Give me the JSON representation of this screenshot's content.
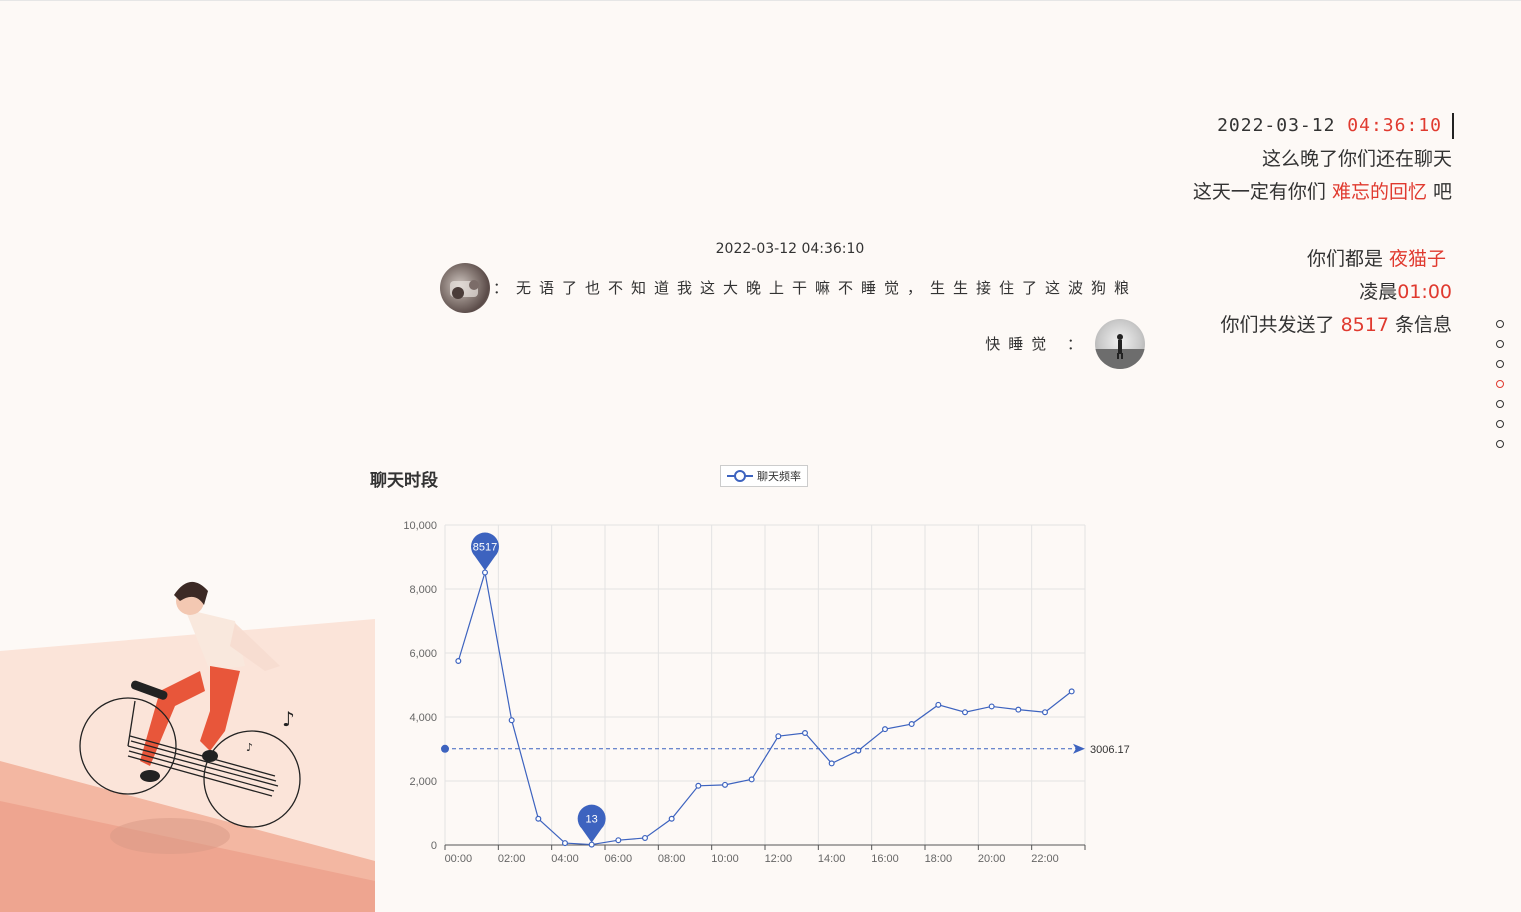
{
  "summary": {
    "date": "2022-03-12",
    "time": "04:36:10",
    "line1": "这么晚了你们还在聊天",
    "line2_prefix": "这天一定有你们 ",
    "line2_highlight": "难忘的回忆",
    "line2_suffix": " 吧",
    "cat_prefix": "你们都是 ",
    "cat_highlight": "夜猫子",
    "early_prefix": "凌晨",
    "early_time": "01:00",
    "count_prefix": "你们共发送了 ",
    "count_value": "8517",
    "count_suffix": " 条信息"
  },
  "chat": {
    "timestamp": "2022-03-12 04:36:10",
    "left_message": "：无语了也不知道我这大晚上干嘛不睡觉，生生接住了这波狗粮",
    "right_message": "快睡觉 ："
  },
  "nav": {
    "dot_count": 7,
    "active_index": 3
  },
  "chart_data": {
    "type": "line",
    "title": "聊天时段",
    "legend": [
      "聊天频率"
    ],
    "x_categories": [
      "00:00",
      "01:00",
      "02:00",
      "03:00",
      "04:00",
      "05:00",
      "06:00",
      "07:00",
      "08:00",
      "09:00",
      "10:00",
      "11:00",
      "12:00",
      "13:00",
      "14:00",
      "15:00",
      "16:00",
      "17:00",
      "18:00",
      "19:00",
      "20:00",
      "21:00",
      "22:00",
      "23:00"
    ],
    "x_tick_labels": [
      "00:00",
      "02:00",
      "04:00",
      "06:00",
      "08:00",
      "10:00",
      "12:00",
      "14:00",
      "16:00",
      "18:00",
      "20:00",
      "22:00"
    ],
    "y_tick_labels": [
      "0",
      "2,000",
      "4,000",
      "6,000",
      "8,000",
      "10,000"
    ],
    "ylim": [
      0,
      10000
    ],
    "series": [
      {
        "name": "聊天频率",
        "values": [
          5750,
          8517,
          3900,
          820,
          60,
          13,
          150,
          220,
          820,
          1850,
          1880,
          2050,
          3400,
          3500,
          2550,
          2950,
          3620,
          3780,
          4380,
          4150,
          4330,
          4230,
          4150,
          4800
        ]
      }
    ],
    "max_marker": {
      "label": "8517",
      "value": 8517,
      "x": "01:00"
    },
    "min_marker": {
      "label": "13",
      "value": 13,
      "x": "05:00"
    },
    "average_line": {
      "label": "3006.17",
      "value": 3006.17
    },
    "grid": true,
    "color": "#3d63bf"
  }
}
